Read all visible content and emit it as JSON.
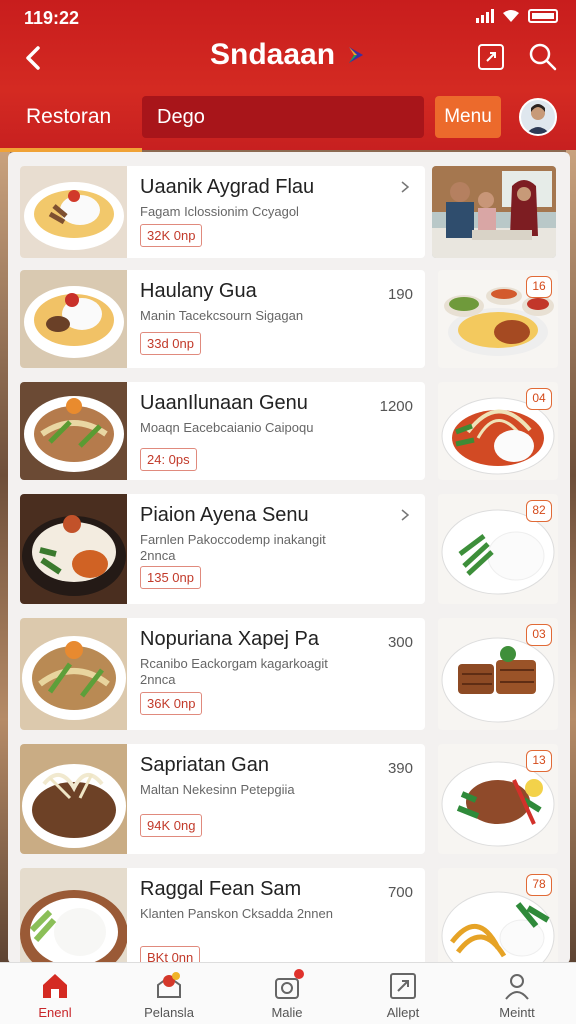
{
  "status_bar": {
    "time": "119:22"
  },
  "header": {
    "title": "Sndaaan",
    "section_tab": "Restoran",
    "search_placeholder": "Dego",
    "menu_label": "Menu"
  },
  "menu_items": [
    {
      "name": "Uaanik Aygrad Flau",
      "desc": "Fagam Iclossionim Ccyagol",
      "price": "32K 0np",
      "num": ""
    },
    {
      "name": "Haulany Gua",
      "desc": "Manin Tacekcsourn Sigagan",
      "price": "33d 0np",
      "num": "190"
    },
    {
      "name": "UaanIlunaan Genu",
      "desc": "Moaqn Eacebcaianio Caipoqu",
      "price": "24: 0ps",
      "num": "1200"
    },
    {
      "name": "Piaion Ayena Senu",
      "desc": "Farnlen Pakoccodemp inakangit 2nnca",
      "price": "135 0np",
      "num": ""
    },
    {
      "name": "Nopuriana Xapej Pa",
      "desc": "Rcanibo Eackorgam kagarkoagit 2nnca",
      "price": "36K 0np",
      "num": "300"
    },
    {
      "name": "Sapriatan Gan",
      "desc": "Maltan Nekesinn Petepgiia",
      "price": "94K 0ng",
      "num": "390"
    },
    {
      "name": "Raggal Fean Sam",
      "desc": "Klanten Panskon Cksadda 2nnen",
      "price": "BKt 0nn",
      "num": "700"
    }
  ],
  "side_badges": [
    "",
    "16",
    "04",
    "82",
    "03",
    "13",
    "78"
  ],
  "bottom_nav": [
    {
      "label": "Enenl",
      "icon": "home-icon",
      "active": true
    },
    {
      "label": "Pelansla",
      "icon": "offer-icon",
      "active": false
    },
    {
      "label": "Malie",
      "icon": "bag-icon",
      "active": false
    },
    {
      "label": "Allept",
      "icon": "receipt-icon",
      "active": false
    },
    {
      "label": "Meintt",
      "icon": "profile-icon",
      "active": false
    }
  ],
  "colors": {
    "brand": "#c81d1d",
    "accent": "#ec6a2c",
    "underline": "#f0a236",
    "price": "#c23a2a"
  }
}
